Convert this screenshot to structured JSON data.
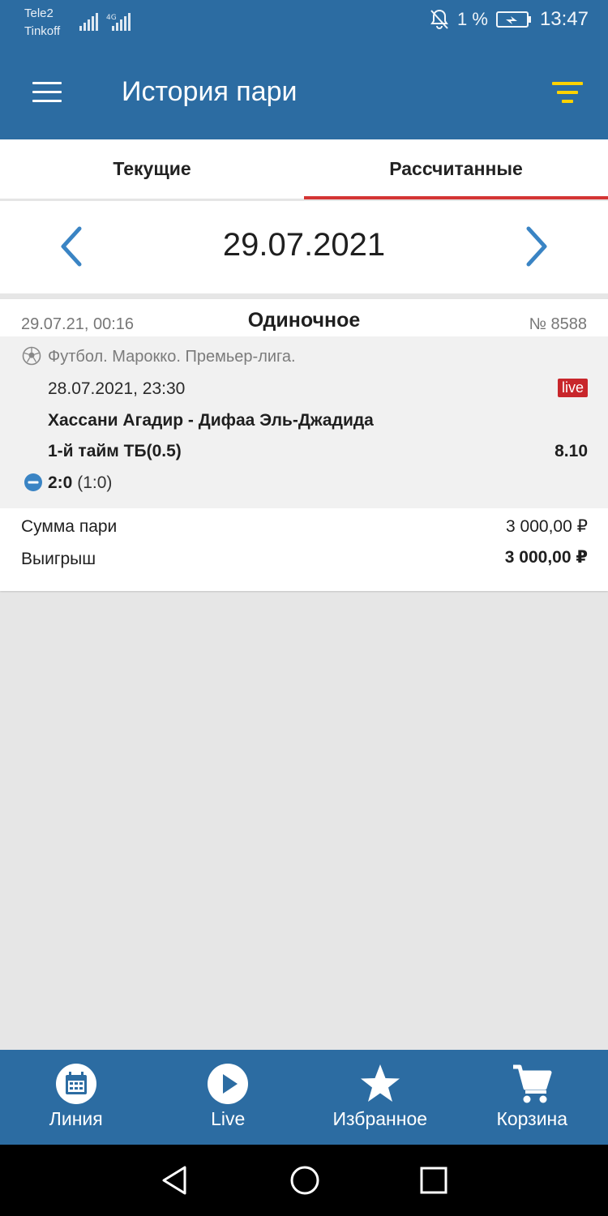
{
  "status_bar": {
    "carrier_1": "Tele2",
    "carrier_2": "Tinkoff",
    "network": "4G",
    "battery": "1 %",
    "time": "13:47"
  },
  "app_bar": {
    "title": "История пари",
    "accent_color": "#ffd200",
    "background_color": "#2c6ca2"
  },
  "tabs": [
    {
      "label": "Текущие",
      "active": false
    },
    {
      "label": "Рассчитанные",
      "active": true
    }
  ],
  "date_nav": {
    "date": "29.07.2021"
  },
  "bet": {
    "placed_at": "29.07.21, 00:16",
    "type": "Одиночное",
    "number": "№ 8588",
    "event": {
      "league": "Футбол. Марокко. Премьер-лига.",
      "datetime": "28.07.2021, 23:30",
      "live_label": "live",
      "match": "Хассани Агадир - Дифаа Эль-Джадида",
      "market": "1-й тайм ТБ(0.5)",
      "odds": "8.10",
      "score": "2:0",
      "score_half": "(1:0)"
    },
    "totals": {
      "stake_label": "Сумма пари",
      "stake_value": "3 000,00 ₽",
      "win_label": "Выигрыш",
      "win_value": "3 000,00 ₽"
    }
  },
  "bottom_nav": [
    {
      "label": "Линия",
      "icon": "calendar-icon"
    },
    {
      "label": "Live",
      "icon": "play-icon"
    },
    {
      "label": "Избранное",
      "icon": "star-icon"
    },
    {
      "label": "Корзина",
      "icon": "cart-icon"
    }
  ]
}
